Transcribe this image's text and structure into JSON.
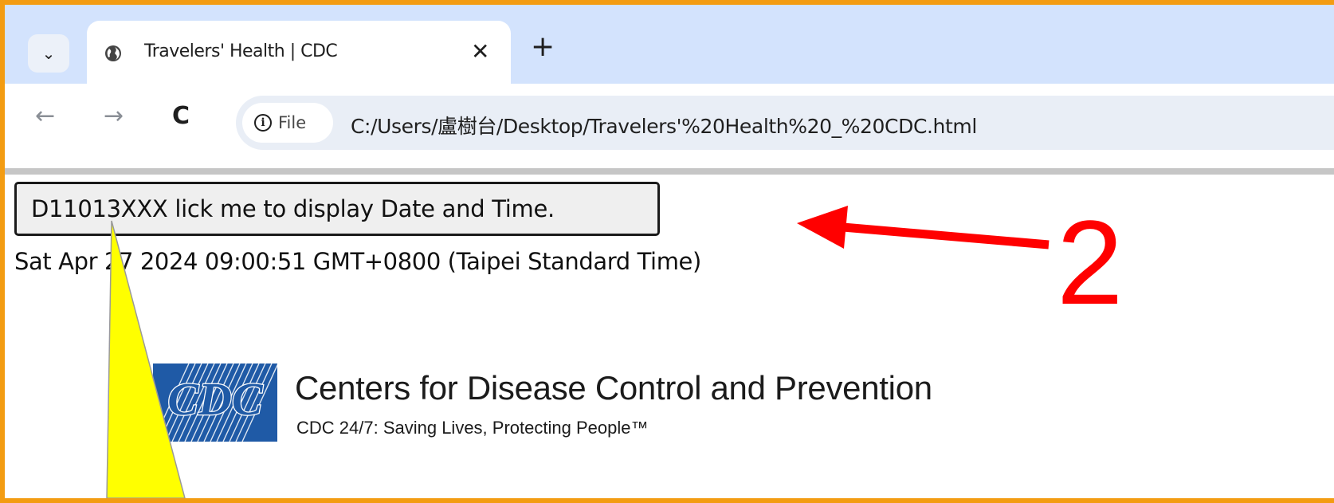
{
  "browser": {
    "tab": {
      "title": "Travelers' Health | CDC",
      "close_symbol": "✕"
    },
    "new_tab_symbol": "+",
    "tab_menu_symbol": "⌄",
    "nav": {
      "back_symbol": "←",
      "forward_symbol": "→",
      "reload_symbol": "C"
    },
    "omnibox": {
      "chip_label": "File",
      "url": "C:/Users/盧樹台/Desktop/Travelers'%20Health%20_%20CDC.html"
    }
  },
  "page": {
    "datetime_button_label": "D11013XXX lick me to display Date and Time.",
    "datetime_output": "Sat Apr 27 2024 09:00:51 GMT+0800 (Taipei Standard Time)",
    "cdc": {
      "logo_text": "CDC",
      "name": "Centers for Disease Control and Prevention",
      "tagline": "CDC 24/7: Saving Lives, Protecting People™"
    }
  },
  "annotations": {
    "step_number": "2",
    "arrow_color": "#ff0000",
    "pointer_color": "#ffff00"
  },
  "colors": {
    "outer_border": "#f39c12",
    "tabstrip": "#d3e3fd",
    "cdc_blue": "#1f5aa6"
  }
}
